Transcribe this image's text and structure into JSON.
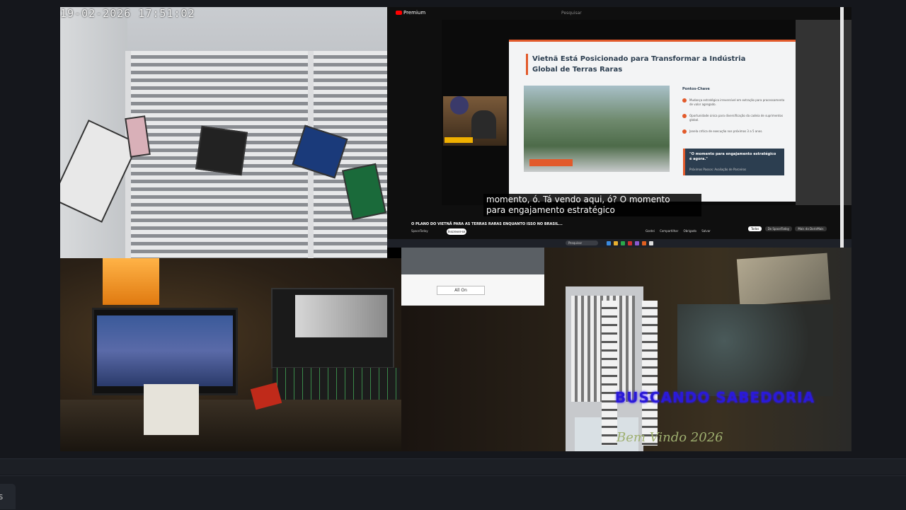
{
  "camera": {
    "timestamp": "19-02-2026 17:51:02"
  },
  "youtube": {
    "logo": "Premium",
    "search_placeholder": "Pesquisar",
    "slide": {
      "title": "Vietnã Está Posicionado para Transformar a Indústria Global de Terras Raras",
      "key_points_header": "Pontos-Chave",
      "key_points": [
        "Mudança estratégica irreversível em extração para processamento de valor agregado.",
        "Oportunidade única para diversificação da cadeia de suprimentos global.",
        "Janela crítica de execução nos próximos 3 a 5 anos."
      ],
      "quote": "\"O momento para engajamento estratégico é agora.\"",
      "quote_source": "Próximos Passos: Avaliação de Parceiros"
    },
    "subtitle_lines": [
      "momento, ó. Tá vendo aqui, ó? O momento",
      "para engajamento estratégico"
    ],
    "video_title": "O PLANO DO VIETNÃ PARA AS TERRAS RARAS ENQUANTO ISSO NO BRASIL...",
    "channel": "SpaceToday",
    "subscribe_label": "Inscrever-se",
    "actions": [
      "Gostei",
      "Compartilhar",
      "Obrigado",
      "Salvar"
    ],
    "chips": [
      "Todos",
      "Do SpaceToday",
      "Mais da DorisMais"
    ],
    "taskbar_search": "Pesquisar"
  },
  "strip": {
    "all_on_label": "All On"
  },
  "overlay": {
    "title": "BUSCANDO SABEDORIA",
    "subtitle": "Bem Vindo 2026"
  },
  "colors": {
    "accent_red": "#e25a2b",
    "slide_navy": "#2c3e50",
    "overlay_blue": "#2a1ad8",
    "overlay_green": "#9fb070"
  }
}
